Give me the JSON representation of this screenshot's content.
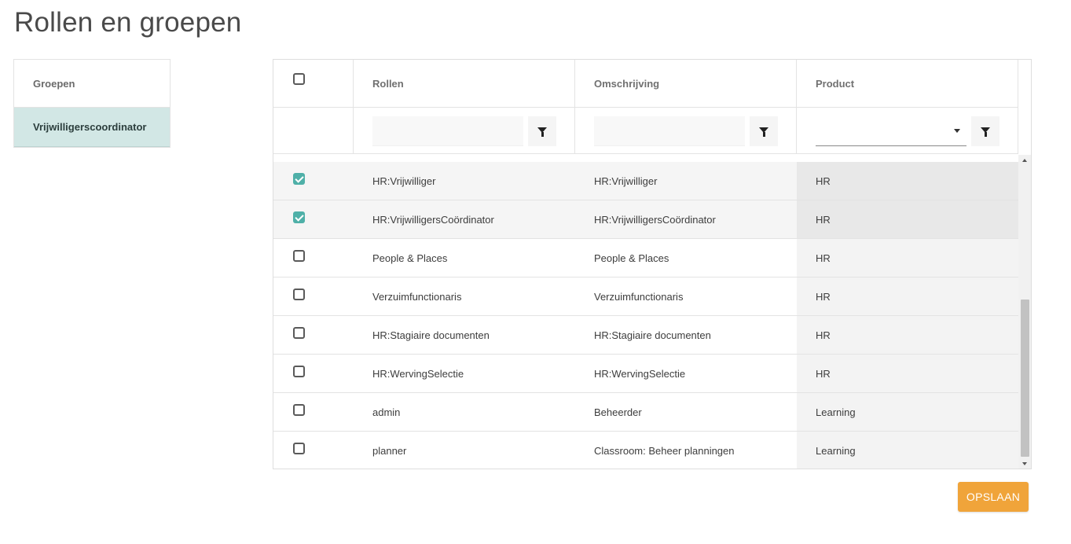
{
  "page": {
    "title": "Rollen en groepen"
  },
  "groups": {
    "header": "Groepen",
    "items": [
      {
        "label": "Vrijwilligerscoordinator",
        "selected": true
      }
    ]
  },
  "table": {
    "headers": {
      "rollen": "Rollen",
      "omschrijving": "Omschrijving",
      "product": "Product"
    },
    "filters": {
      "rollen": "",
      "omschrijving": "",
      "product": ""
    },
    "rows": [
      {
        "checked": true,
        "rol": "HR:Vrijwilliger",
        "omschrijving": "HR:Vrijwilliger",
        "product": "HR"
      },
      {
        "checked": true,
        "rol": "HR:VrijwilligersCoördinator",
        "omschrijving": "HR:VrijwilligersCoördinator",
        "product": "HR"
      },
      {
        "checked": false,
        "rol": "People & Places",
        "omschrijving": "People & Places",
        "product": "HR"
      },
      {
        "checked": false,
        "rol": "Verzuimfunctionaris",
        "omschrijving": "Verzuimfunctionaris",
        "product": "HR"
      },
      {
        "checked": false,
        "rol": "HR:Stagiaire documenten",
        "omschrijving": "HR:Stagiaire documenten",
        "product": "HR"
      },
      {
        "checked": false,
        "rol": "HR:WervingSelectie",
        "omschrijving": "HR:WervingSelectie",
        "product": "HR"
      },
      {
        "checked": false,
        "rol": "admin",
        "omschrijving": "Beheerder",
        "product": "Learning"
      },
      {
        "checked": false,
        "rol": "planner",
        "omschrijving": "Classroom: Beheer planningen",
        "product": "Learning"
      }
    ]
  },
  "actions": {
    "save_label": "OPSLAAN"
  },
  "colors": {
    "accent": "#4fb0a8",
    "save": "#f0a43a",
    "group_selected": "#d2e7e5"
  }
}
